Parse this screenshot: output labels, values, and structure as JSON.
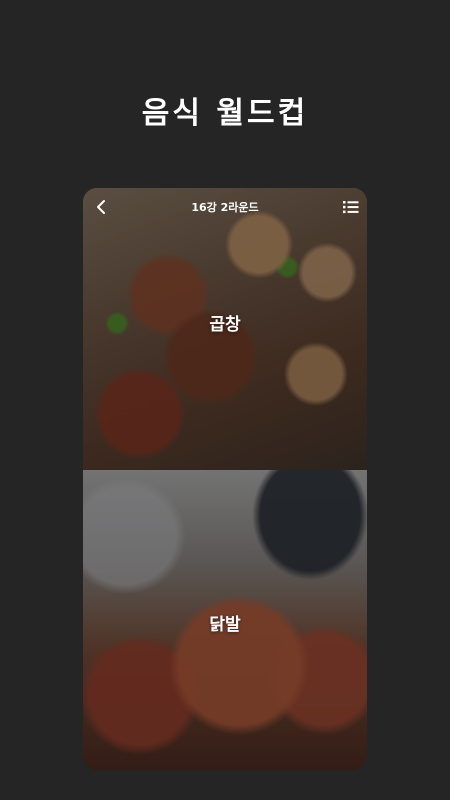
{
  "page": {
    "title": "음식 월드컵"
  },
  "card": {
    "round": "16강 2라운드",
    "icons": {
      "back": "chevron-left-icon",
      "list": "list-icon"
    },
    "options": [
      {
        "label": "곱창"
      },
      {
        "label": "닭발"
      }
    ]
  }
}
